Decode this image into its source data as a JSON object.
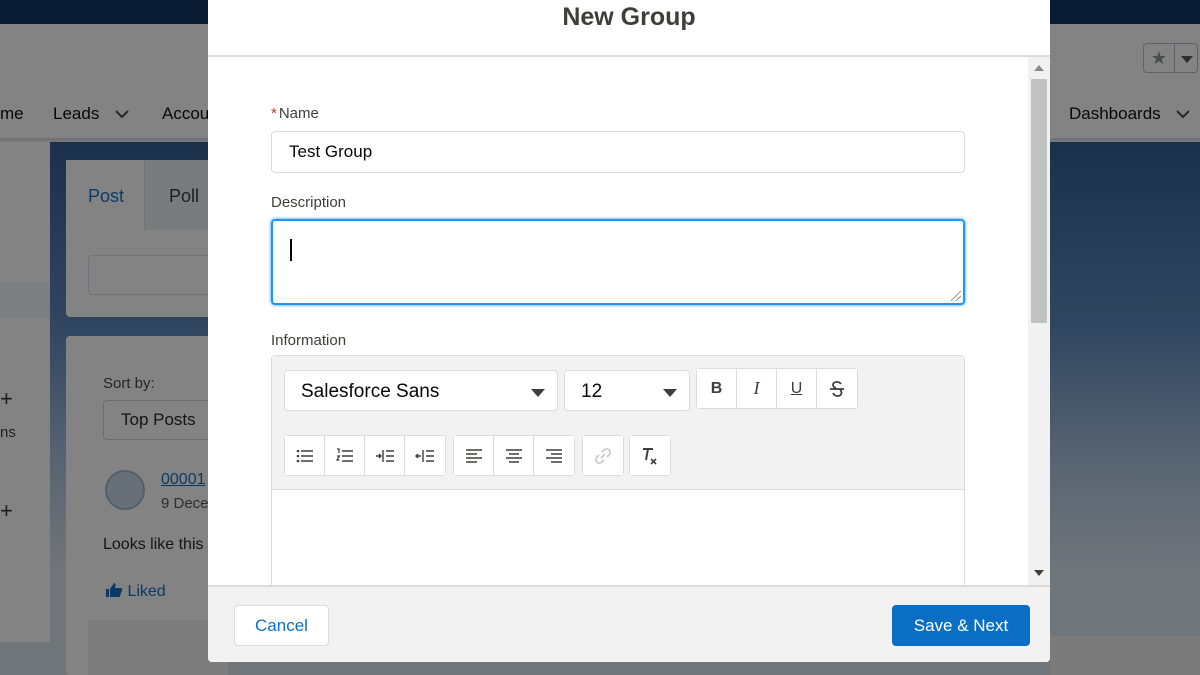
{
  "background": {
    "nav": {
      "home_partial": "me",
      "leads": "Leads",
      "accounts_partial": "Accou",
      "dashboards": "Dashboards"
    },
    "feed_tabs": {
      "post": "Post",
      "poll": "Poll"
    },
    "sort": {
      "label": "Sort by:",
      "value": "Top Posts"
    },
    "post": {
      "id_partial": "00001",
      "date_partial": "9 Dece",
      "text_partial": "Looks like this",
      "liked": "Liked"
    },
    "left_partial_text": "ns"
  },
  "modal": {
    "title": "New Group",
    "fields": {
      "name": {
        "label": "Name",
        "required_mark": "*",
        "value": "Test Group"
      },
      "description": {
        "label": "Description",
        "value": ""
      },
      "information": {
        "label": "Information"
      }
    },
    "editor": {
      "font": "Salesforce Sans",
      "size": "12",
      "format_buttons": [
        "B",
        "I",
        "U"
      ]
    },
    "footer": {
      "cancel_label": "Cancel",
      "save_label": "Save & Next"
    }
  },
  "colors": {
    "brand_blue": "#0b6ec5",
    "focus_blue": "#1b96ff",
    "required_red": "#c23934"
  }
}
